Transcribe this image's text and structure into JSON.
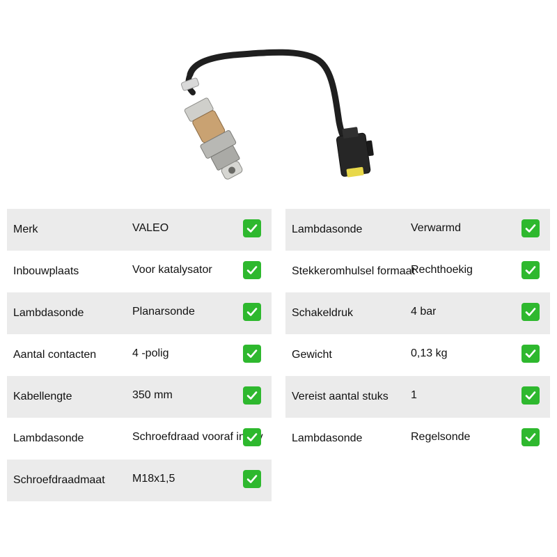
{
  "product_image": {
    "icon": "lambda-sensor-with-connector",
    "colors": {
      "cable": "#1f1f1f",
      "metal": "#b8b8b4",
      "connector_accent": "#e8d84a"
    }
  },
  "specs_left": [
    {
      "label": "Merk",
      "value": "VALEO",
      "ok": true
    },
    {
      "label": "Inbouwplaats",
      "value": "Voor katalysator",
      "ok": true
    },
    {
      "label": "Lambdasonde",
      "value": "Planarsonde",
      "ok": true
    },
    {
      "label": "Aantal contacten",
      "value": "4 -polig",
      "ok": true
    },
    {
      "label": "Kabellengte",
      "value": "350 mm",
      "ok": true
    },
    {
      "label": "Lambdasonde",
      "value": "Schroefdraad vooraf ingev",
      "ok": true
    },
    {
      "label": "Schroefdraadmaat",
      "value": "M18x1,5",
      "ok": true
    }
  ],
  "specs_right": [
    {
      "label": "Lambdasonde",
      "value": "Verwarmd",
      "ok": true
    },
    {
      "label": "Stekkeromhulsel formaat",
      "value": "Rechthoekig",
      "ok": true
    },
    {
      "label": "Schakeldruk",
      "value": "4 bar",
      "ok": true
    },
    {
      "label": "Gewicht",
      "value": "0,13 kg",
      "ok": true
    },
    {
      "label": "Vereist aantal stuks",
      "value": "1",
      "ok": true
    },
    {
      "label": "Lambdasonde",
      "value": "Regelsonde",
      "ok": true
    }
  ],
  "check_icon": {
    "name": "check-mark-icon",
    "color": "#2eb82e"
  }
}
